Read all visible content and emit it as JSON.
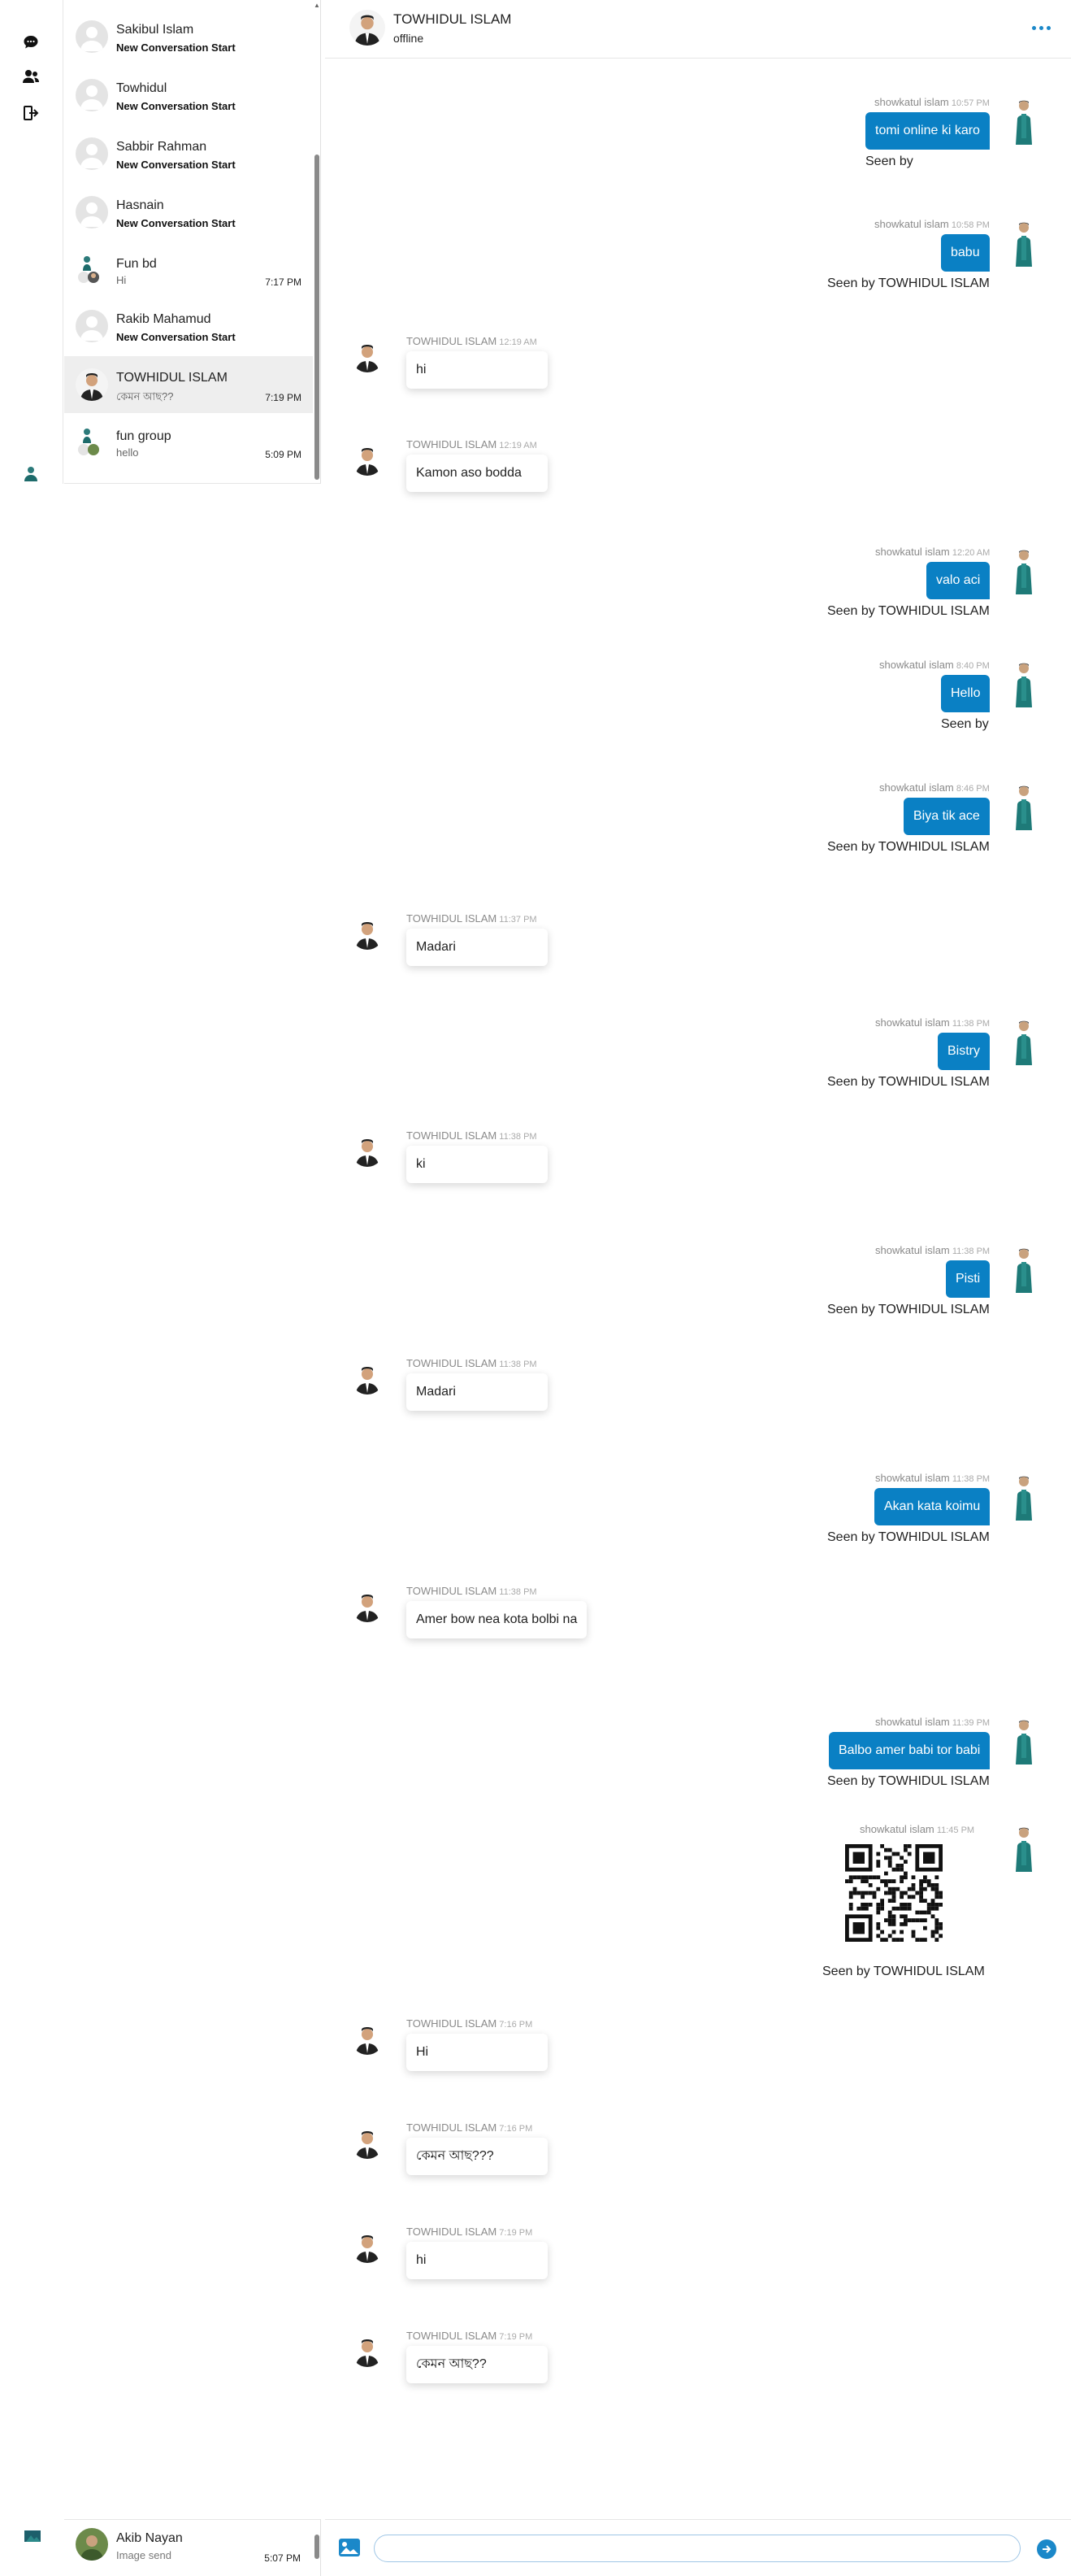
{
  "header": {
    "name": "TOWHIDUL ISLAM",
    "status": "offline"
  },
  "conversations": [
    {
      "name": "Sakibul Islam",
      "sub": "New Conversation Start",
      "time": ""
    },
    {
      "name": "Towhidul",
      "sub": "New Conversation Start",
      "time": ""
    },
    {
      "name": "Sabbir Rahman",
      "sub": "New Conversation Start",
      "time": ""
    },
    {
      "name": "Hasnain",
      "sub": "New Conversation Start",
      "time": ""
    },
    {
      "name": "Fun bd",
      "sub": "Hi",
      "time": "7:17 PM"
    },
    {
      "name": "Rakib Mahamud",
      "sub": "New Conversation Start",
      "time": ""
    },
    {
      "name": "TOWHIDUL ISLAM",
      "sub": "কেমন আছ??",
      "time": "7:19 PM"
    },
    {
      "name": "fun group",
      "sub": "hello",
      "time": "5:09 PM"
    }
  ],
  "me": {
    "name": "Akib Nayan",
    "sub": "Image send",
    "time": "5:07 PM"
  },
  "messages": [
    {
      "sender": "showkatul islam",
      "time": "10:57 PM",
      "text": "tomi online ki karo",
      "seen": "Seen by"
    },
    {
      "sender": "showkatul islam",
      "time": "10:58 PM",
      "text": "babu",
      "seen": "Seen by TOWHIDUL ISLAM"
    },
    {
      "sender": "TOWHIDUL ISLAM",
      "time": "12:19 AM",
      "text": "hi"
    },
    {
      "sender": "TOWHIDUL ISLAM",
      "time": "12:19 AM",
      "text": "Kamon aso bodda"
    },
    {
      "sender": "showkatul islam",
      "time": "12:20 AM",
      "text": "valo aci",
      "seen": "Seen by TOWHIDUL ISLAM"
    },
    {
      "sender": "showkatul islam",
      "time": "8:40 PM",
      "text": "Hello",
      "seen": "Seen by"
    },
    {
      "sender": "showkatul islam",
      "time": "8:46 PM",
      "text": "Biya tik ace",
      "seen": "Seen by TOWHIDUL ISLAM"
    },
    {
      "sender": "TOWHIDUL ISLAM",
      "time": "11:37 PM",
      "text": "Madari"
    },
    {
      "sender": "showkatul islam",
      "time": "11:38 PM",
      "text": "Bistry",
      "seen": "Seen by TOWHIDUL ISLAM"
    },
    {
      "sender": "TOWHIDUL ISLAM",
      "time": "11:38 PM",
      "text": "ki"
    },
    {
      "sender": "showkatul islam",
      "time": "11:38 PM",
      "text": "Pisti",
      "seen": "Seen by TOWHIDUL ISLAM"
    },
    {
      "sender": "TOWHIDUL ISLAM",
      "time": "11:38 PM",
      "text": "Madari"
    },
    {
      "sender": "showkatul islam",
      "time": "11:38 PM",
      "text": "Akan kata koimu",
      "seen": "Seen by TOWHIDUL ISLAM"
    },
    {
      "sender": "TOWHIDUL ISLAM",
      "time": "11:38 PM",
      "text": "Amer bow nea kota bolbi na"
    },
    {
      "sender": "showkatul islam",
      "time": "11:39 PM",
      "text": "Balbo amer babi tor babi",
      "seen": "Seen by TOWHIDUL ISLAM"
    },
    {
      "sender": "showkatul islam",
      "time": "11:45 PM",
      "seen": "Seen by TOWHIDUL ISLAM"
    },
    {
      "sender": "TOWHIDUL ISLAM",
      "time": "7:16 PM",
      "text": "Hi"
    },
    {
      "sender": "TOWHIDUL ISLAM",
      "time": "7:16 PM",
      "text": "কেমন আছ???"
    },
    {
      "sender": "TOWHIDUL ISLAM",
      "time": "7:19 PM",
      "text": "hi"
    },
    {
      "sender": "TOWHIDUL ISLAM",
      "time": "7:19 PM",
      "text": "কেমন আছ??"
    }
  ],
  "composer": {
    "placeholder": ""
  },
  "colors": {
    "accent": "#0a80c4",
    "active_row": "#eeeeee"
  }
}
